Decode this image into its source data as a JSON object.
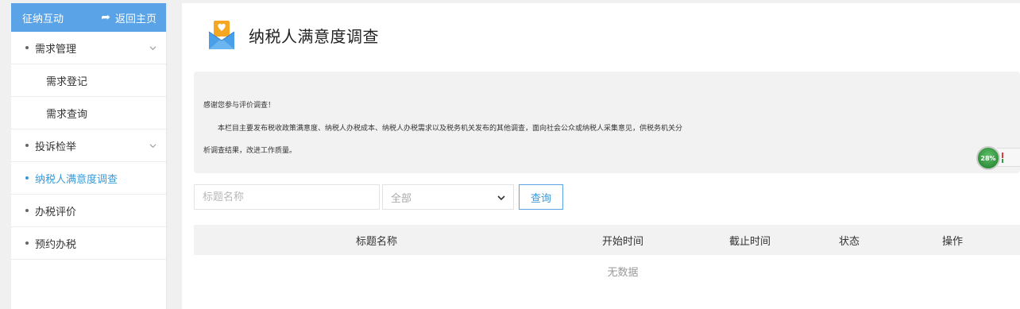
{
  "sidebar": {
    "header": "征纳互动",
    "back_label": "返回主页",
    "items": [
      {
        "label": "需求管理"
      },
      {
        "label": "需求登记"
      },
      {
        "label": "需求查询"
      },
      {
        "label": "投诉检举"
      },
      {
        "label": "纳税人满意度调查"
      },
      {
        "label": "办税评价"
      },
      {
        "label": "预约办税"
      }
    ]
  },
  "main": {
    "title": "纳税人满意度调查",
    "notice": {
      "line1": "感谢您参与评价调查！",
      "line2": "本栏目主要发布税收政策满意度、纳税人办税成本、纳税人办税需求以及税务机关发布的其他调查，面向社会公众或纳税人采集意见，供税务机关分",
      "line3": "析调查结果，改进工作质量。"
    },
    "progress_label": "28%",
    "search": {
      "placeholder": "标题名称",
      "status_value": "全部",
      "query_label": "查询"
    },
    "table": {
      "columns": [
        "标题名称",
        "开始时间",
        "截止时间",
        "状态",
        "操作"
      ],
      "empty_text": "无数据"
    }
  },
  "colors": {
    "accent": "#5aa3e6",
    "active_text": "#3a9ad9",
    "progress_green": "#2f8f3a"
  },
  "icons": {
    "back": "back-arrow-icon",
    "chevron": "chevron-down-icon",
    "title": "survey-envelope-icon",
    "select": "caret-down-icon"
  }
}
